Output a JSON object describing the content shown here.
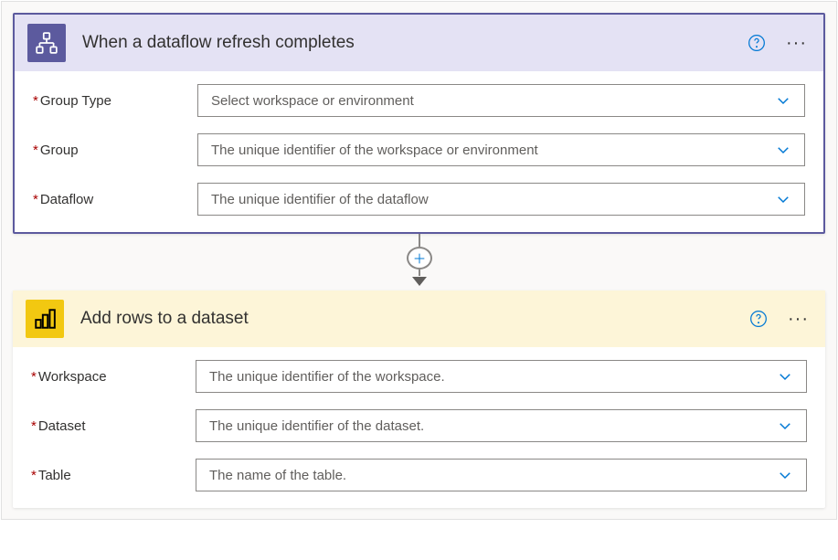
{
  "trigger": {
    "title": "When a dataflow refresh completes",
    "fields": [
      {
        "label": "Group Type",
        "placeholder": "Select workspace or environment"
      },
      {
        "label": "Group",
        "placeholder": "The unique identifier of the workspace or environment"
      },
      {
        "label": "Dataflow",
        "placeholder": "The unique identifier of the dataflow"
      }
    ]
  },
  "action": {
    "title": "Add rows to a dataset",
    "fields": [
      {
        "label": "Workspace",
        "placeholder": "The unique identifier of the workspace."
      },
      {
        "label": "Dataset",
        "placeholder": "The unique identifier of the dataset."
      },
      {
        "label": "Table",
        "placeholder": "The name of the table."
      }
    ]
  }
}
